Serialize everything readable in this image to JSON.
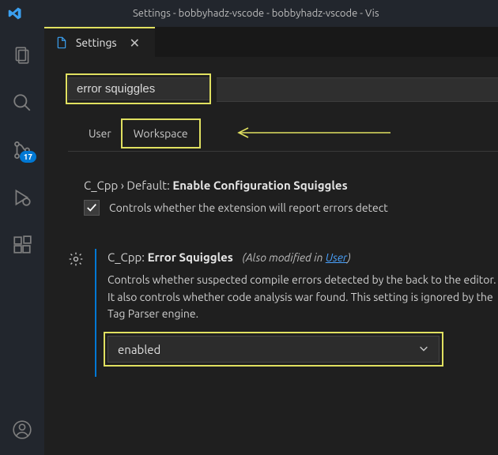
{
  "window": {
    "title": "Settings - bobbyhadz-vscode - bobbyhadz-vscode - Vis"
  },
  "activitybar": {
    "scm_badge": "17"
  },
  "tab": {
    "label": "Settings",
    "close": "✕"
  },
  "search": {
    "value": "error squiggles"
  },
  "scope": {
    "user": "User",
    "workspace": "Workspace"
  },
  "setting1": {
    "category": "C_Cpp › Default:",
    "name": "Enable Configuration Squiggles",
    "description": "Controls whether the extension will report errors detect"
  },
  "setting2": {
    "category": "C_Cpp:",
    "name": "Error Squiggles",
    "also_prefix": "(Also modified in ",
    "also_link": "User",
    "also_suffix": ")",
    "description": "Controls whether suspected compile errors detected by the back to the editor. It also controls whether code analysis war found. This setting is ignored by the Tag Parser engine.",
    "value": "enabled"
  }
}
